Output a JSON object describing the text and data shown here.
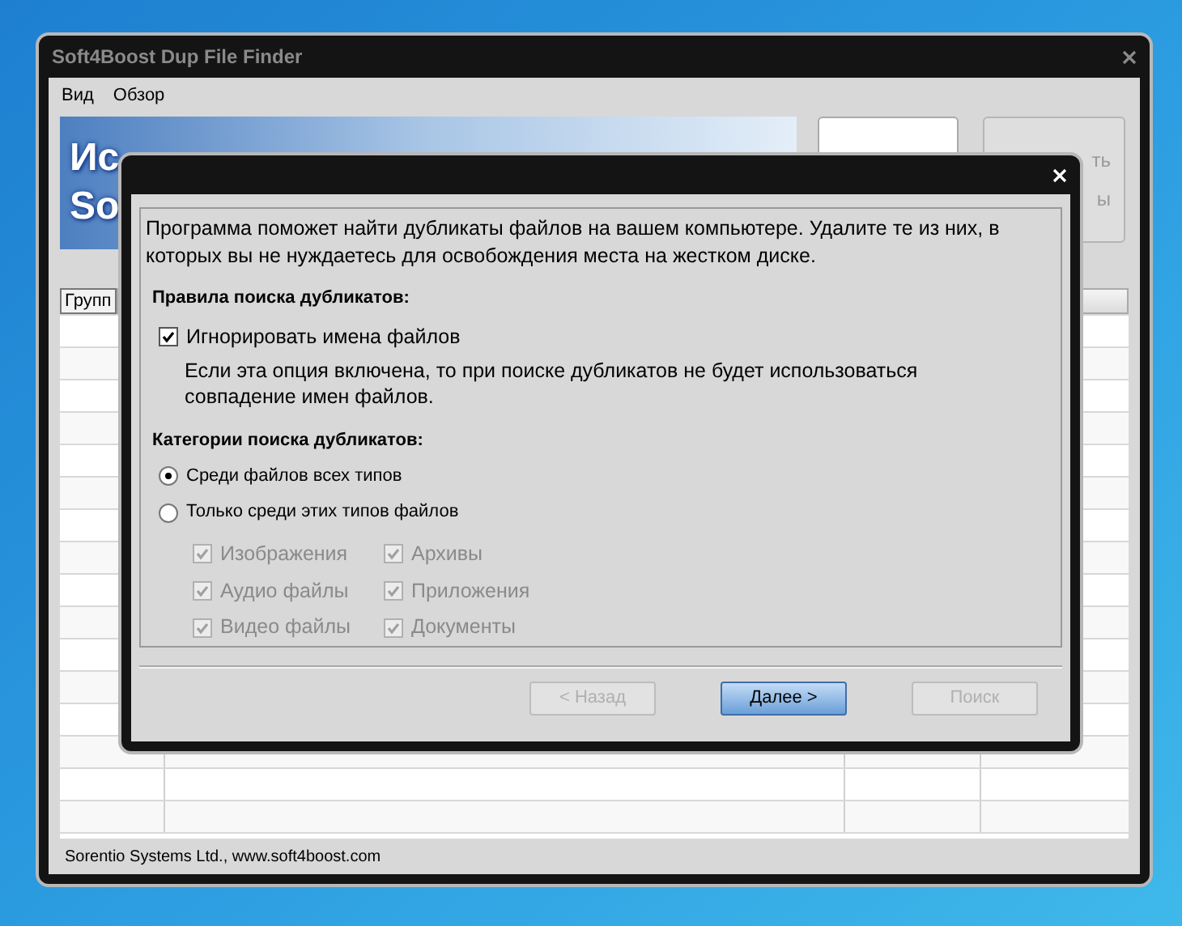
{
  "window": {
    "title": "Soft4Boost Dup File Finder"
  },
  "menu": [
    {
      "label": "Вид"
    },
    {
      "label": "Обзор"
    }
  ],
  "banner": {
    "lines": [
      "Ис",
      "So"
    ]
  },
  "side_button": {
    "fragments": [
      "ть",
      "ы"
    ]
  },
  "group_button": {
    "label": "Групп"
  },
  "status_bar": "Sorentio Systems Ltd., www.soft4boost.com",
  "dialog": {
    "intro": "Программа поможет найти дубликаты файлов на вашем компьютере. Удалите те из них, в которых вы не нуждаетесь для освобождения места на жестком диске.",
    "rules_heading": "Правила поиска дубликатов:",
    "ignore_names": {
      "label": "Игнорировать имена файлов",
      "checked": true,
      "disabled": false
    },
    "ignore_hint": "Если эта опция включена, то при поиске дубликатов не будет использоваться совпадение имен файлов.",
    "categories_heading": "Категории поиска дубликатов:",
    "modes": [
      {
        "label": "Среди файлов всех типов",
        "selected": true
      },
      {
        "label": "Только среди этих типов файлов",
        "selected": false
      }
    ],
    "types": [
      {
        "label": "Изображения",
        "checked": true,
        "disabled": true
      },
      {
        "label": "Архивы",
        "checked": true,
        "disabled": true
      },
      {
        "label": "Аудио файлы",
        "checked": true,
        "disabled": true
      },
      {
        "label": "Приложения",
        "checked": true,
        "disabled": true
      },
      {
        "label": "Видео файлы",
        "checked": true,
        "disabled": true
      },
      {
        "label": "Документы",
        "checked": true,
        "disabled": true
      }
    ],
    "buttons": [
      {
        "label": "< Назад",
        "disabled": true,
        "primary": false
      },
      {
        "label": "Далее >",
        "disabled": false,
        "primary": true
      },
      {
        "label": "Поиск",
        "disabled": true,
        "primary": false
      }
    ]
  }
}
